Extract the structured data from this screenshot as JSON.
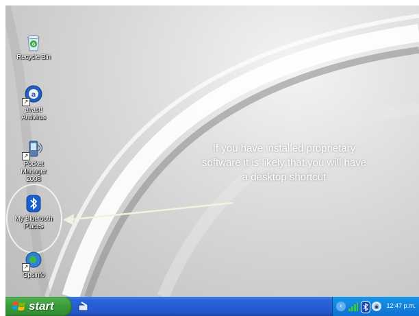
{
  "desktop": {
    "icons": [
      {
        "label": "Recycle Bin",
        "icon": "recycle-bin-icon"
      },
      {
        "label": "avast! Antivirus",
        "icon": "avast-icon"
      },
      {
        "label": "Pocket Manager 2008",
        "icon": "pocket-manager-icon"
      },
      {
        "label": "My Bluetooth Places",
        "icon": "bluetooth-icon"
      },
      {
        "label": "Gpsinfo",
        "icon": "gpsinfo-icon"
      }
    ],
    "callout_text": "If you have installed proprietary software it is likely that you will have a desktop shortcut",
    "callout_color": "#ffffff",
    "highlight_color": "#f0f4e8"
  },
  "taskbar": {
    "start_label": "start",
    "quick_launch_icon": "show-desktop-icon",
    "tray_icons": [
      "back-arrow-icon",
      "signal-icon",
      "bluetooth-tray-icon",
      "speaker-icon"
    ],
    "clock": "12:47 p.m."
  }
}
